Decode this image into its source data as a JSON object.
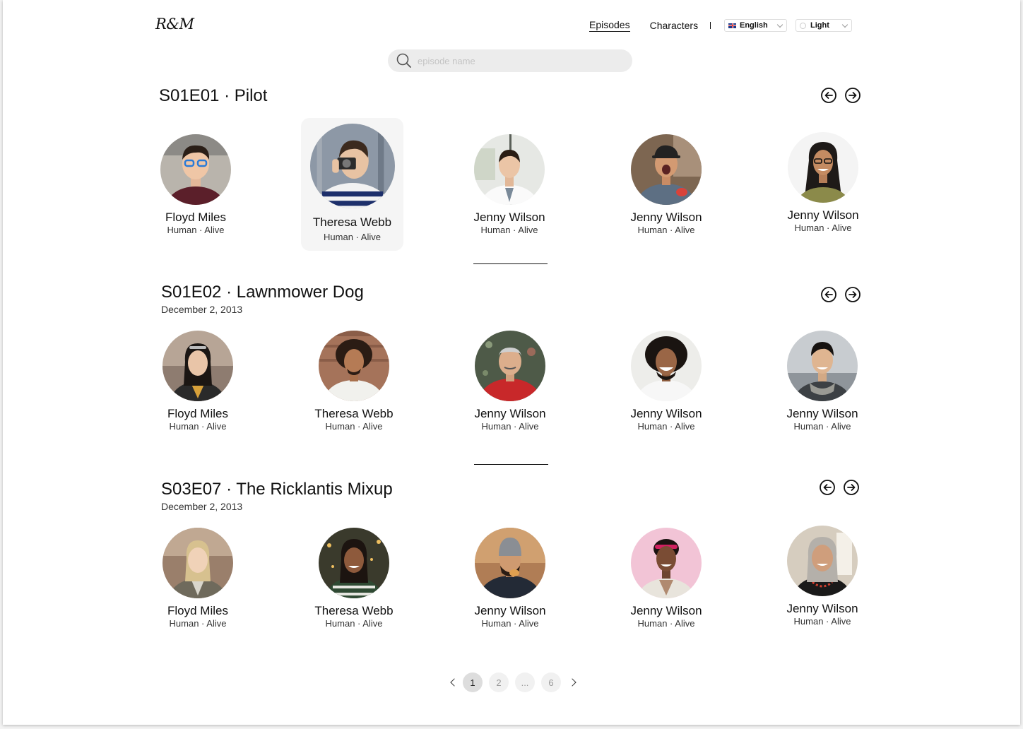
{
  "header": {
    "logo": "R&M",
    "nav": [
      {
        "label": "Episodes",
        "active": true
      },
      {
        "label": "Characters",
        "active": false
      }
    ],
    "language": "English",
    "theme": "Light"
  },
  "search": {
    "placeholder": "episode name",
    "value": ""
  },
  "episodes": [
    {
      "title": "S01E01 · Pilot",
      "date": "",
      "characters": [
        {
          "name": "Floyd Miles",
          "meta": "Human · Alive"
        },
        {
          "name": "Theresa Webb",
          "meta": "Human · Alive"
        },
        {
          "name": "Jenny Wilson",
          "meta": "Human · Alive"
        },
        {
          "name": "Jenny Wilson",
          "meta": "Human · Alive"
        },
        {
          "name": "Jenny Wilson",
          "meta": "Human · Alive"
        }
      ]
    },
    {
      "title": "S01E02 · Lawnmower Dog",
      "date": "December 2, 2013",
      "characters": [
        {
          "name": "Floyd Miles",
          "meta": "Human · Alive"
        },
        {
          "name": "Theresa Webb",
          "meta": "Human · Alive"
        },
        {
          "name": "Jenny Wilson",
          "meta": "Human · Alive"
        },
        {
          "name": "Jenny Wilson",
          "meta": "Human · Alive"
        },
        {
          "name": "Jenny Wilson",
          "meta": "Human · Alive"
        }
      ]
    },
    {
      "title": "S03E07 · The Ricklantis Mixup",
      "date": "December 2, 2013",
      "characters": [
        {
          "name": "Floyd Miles",
          "meta": "Human · Alive"
        },
        {
          "name": "Theresa Webb",
          "meta": "Human · Alive"
        },
        {
          "name": "Jenny Wilson",
          "meta": "Human · Alive"
        },
        {
          "name": "Jenny Wilson",
          "meta": "Human · Alive"
        },
        {
          "name": "Jenny Wilson",
          "meta": "Human · Alive"
        }
      ]
    }
  ],
  "pagination": {
    "pages": [
      "1",
      "2",
      "...",
      "6"
    ],
    "current": "1"
  },
  "colors": {
    "text": "#111111",
    "search_bg": "#ececec",
    "highlight_card": "#f5f5f5",
    "page_active": "#dddddd"
  },
  "icons": {
    "search": "search-icon",
    "prev": "arrow-left-circle-icon",
    "next": "arrow-right-circle-icon"
  }
}
